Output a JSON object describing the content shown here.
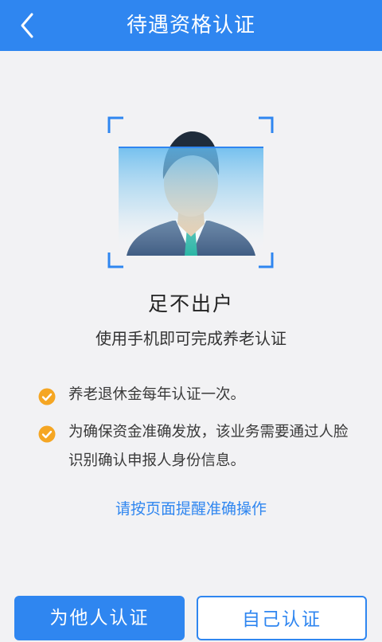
{
  "header": {
    "title": "待遇资格认证",
    "back_icon": "chevron-left-icon"
  },
  "hero": {
    "headline": "足不出户",
    "subline": "使用手机即可完成养老认证"
  },
  "notes": [
    {
      "icon": "check-circle-icon",
      "text": "养老退休金每年认证一次。"
    },
    {
      "icon": "check-circle-icon",
      "text": "为确保资金准确发放，该业务需要通过人脸识别确认申报人身份信息。"
    }
  ],
  "hint_link": "请按页面提醒准确操作",
  "buttons": {
    "other_label": "为他人认证",
    "self_label": "自己认证"
  },
  "colors": {
    "brand": "#2f86f0",
    "check": "#f5a623",
    "background": "#f2f2f4"
  }
}
